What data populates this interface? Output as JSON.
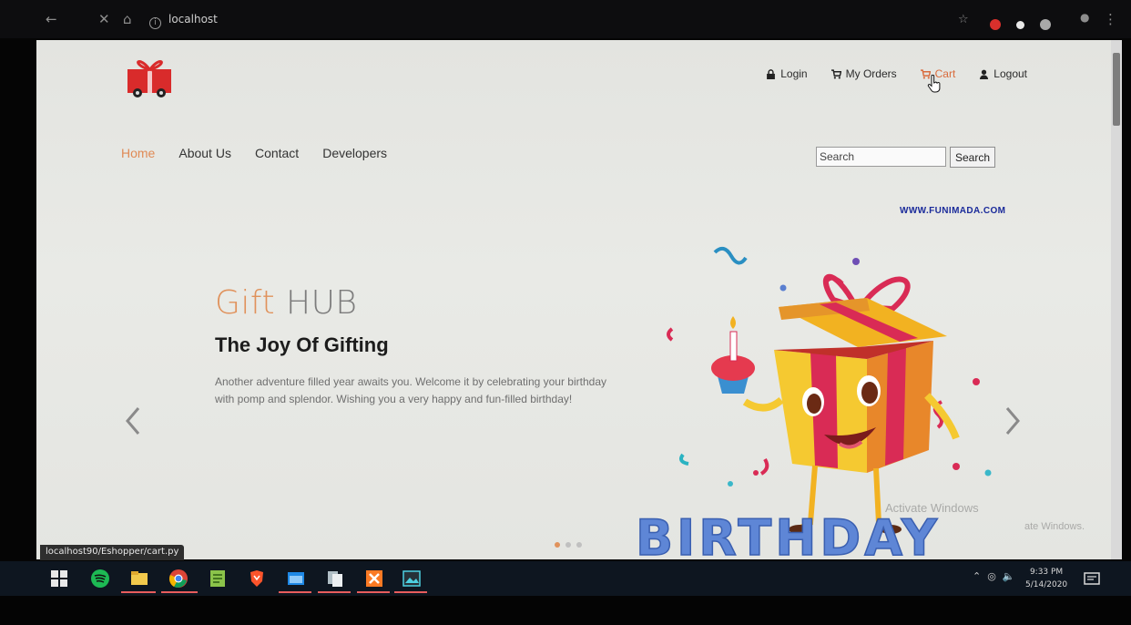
{
  "browser": {
    "url": "localhost",
    "back_icon": "arrow-left-icon",
    "stop_icon": "close-icon",
    "home_icon": "home-icon"
  },
  "header": {
    "top_links": [
      {
        "label": "Login",
        "icon": "lock-icon"
      },
      {
        "label": "My Orders",
        "icon": "cart-icon"
      },
      {
        "label": "Cart",
        "icon": "cart-icon",
        "active": true
      },
      {
        "label": "Logout",
        "icon": "user-icon"
      }
    ],
    "main_nav": [
      {
        "label": "Home",
        "active": true
      },
      {
        "label": "About Us"
      },
      {
        "label": "Contact"
      },
      {
        "label": "Developers"
      }
    ],
    "search": {
      "value": "Search",
      "button": "Search"
    }
  },
  "slider": {
    "brand_part1": "Gift",
    "brand_part2": "HUB",
    "subtitle": "The Joy Of Gifting",
    "description": "Another adventure filled year awaits you. Welcome it by celebrating your birthday with pomp and splendor. Wishing you a very happy and fun-filled birthday!",
    "image_watermark": "WWW.FUNIMADA.COM",
    "image_text": "BIRTHDAY",
    "active_slide": 1,
    "slide_count": 3
  },
  "overlay": {
    "activate_title": "Activate Windows",
    "activate_sub": "ate Windows."
  },
  "status_bar": {
    "url": "localhost90/Eshopper/cart.py"
  },
  "taskbar": {
    "time": "9:33 PM",
    "date": "5/14/2020"
  },
  "colors": {
    "accent": "#e0925c",
    "cart_active": "#d96b3c",
    "logo_red": "#d92b2b"
  }
}
